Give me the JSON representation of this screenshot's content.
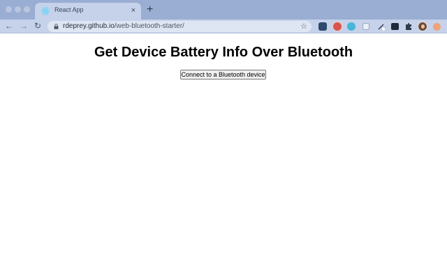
{
  "browser": {
    "tab": {
      "title": "React App",
      "close_glyph": "×",
      "favicon": "react-icon"
    },
    "new_tab_glyph": "+",
    "nav": {
      "back_glyph": "←",
      "forward_glyph": "→",
      "reload_glyph": "↻"
    },
    "address": {
      "host": "rdeprey.github.io",
      "path": "/web-bluetooth-starter/",
      "star_glyph": "☆"
    },
    "extensions": [
      "extension-icon-1",
      "extension-icon-2",
      "extension-icon-3",
      "extension-icon-4",
      "extension-icon-5",
      "extension-icon-6",
      "puzzle-icon",
      "profile-avatar",
      "extension-icon-8"
    ]
  },
  "page": {
    "heading": "Get Device Battery Info Over Bluetooth",
    "connect_button_label": "Connect to a Bluetooth device"
  },
  "colors": {
    "tabstrip": "#9aaed3",
    "toolbar": "#c5d2ea",
    "page_background": "#ffffff"
  }
}
